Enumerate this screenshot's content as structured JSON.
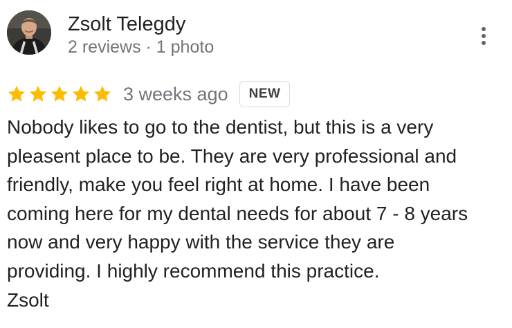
{
  "review": {
    "author": {
      "name": "Zsolt Telegdy",
      "meta": "2 reviews · 1 photo",
      "avatar": "avatar-photo"
    },
    "more_options_icon": "more-vert-icon",
    "rating": {
      "stars": 5,
      "max_stars": 5,
      "star_color": "#fbbc04"
    },
    "time": "3 weeks ago",
    "badge": "NEW",
    "text": "Nobody likes to go to the dentist, but this is a very\npleasent place to be. They are very professional and\nfriendly, make you feel right at home. I have been\ncoming here for my dental needs for about 7 - 8 years\nnow and very happy with the service they are\nproviding. I highly recommend this practice.\nZsolt"
  }
}
